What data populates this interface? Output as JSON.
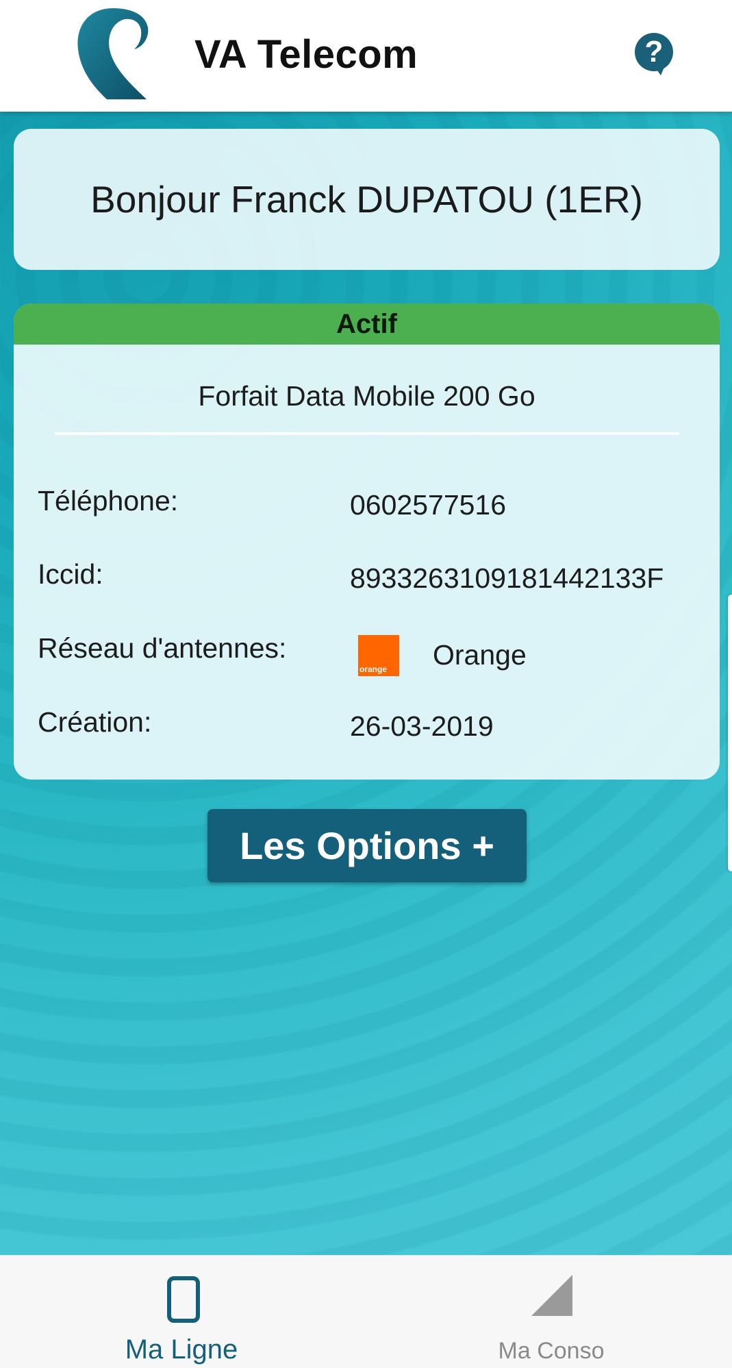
{
  "header": {
    "title": "VA Telecom",
    "help_icon": "help-bubble-icon",
    "logo_icon": "va-telecom-logo"
  },
  "greeting": {
    "text": "Bonjour Franck DUPATOU (1ER)"
  },
  "line": {
    "status": "Actif",
    "status_color": "#4caf50",
    "plan": "Forfait Data Mobile 200 Go",
    "rows": [
      {
        "label": "Téléphone:",
        "value": "0602577516"
      },
      {
        "label": "Iccid:",
        "value": "89332631091814421 33F"
      },
      {
        "label": "Réseau d'antennes:",
        "value": "Orange"
      },
      {
        "label": "Création:",
        "value": "26-03-2019"
      }
    ],
    "network_logo_text": "orange",
    "network_logo_color": "#ff6600"
  },
  "options_button": {
    "label": "Les Options +"
  },
  "bottom_nav": {
    "items": [
      {
        "label": "Ma Ligne",
        "icon": "phone-icon",
        "active": true
      },
      {
        "label": "Ma Conso",
        "icon": "signal-icon",
        "active": false
      }
    ]
  },
  "colors": {
    "primary": "#14607a",
    "accent_green": "#4caf50",
    "background": "#2fbbc8"
  }
}
